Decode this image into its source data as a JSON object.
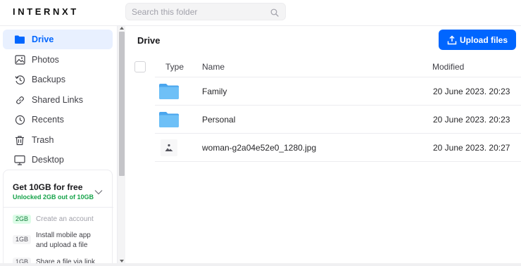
{
  "app": {
    "logo": "INTERNXT"
  },
  "search": {
    "placeholder": "Search this folder"
  },
  "sidebar": {
    "items": [
      {
        "label": "Drive",
        "icon": "folder-icon",
        "active": true
      },
      {
        "label": "Photos",
        "icon": "image-icon"
      },
      {
        "label": "Backups",
        "icon": "clock-counter-icon"
      },
      {
        "label": "Shared Links",
        "icon": "link-icon"
      },
      {
        "label": "Recents",
        "icon": "clock-icon"
      },
      {
        "label": "Trash",
        "icon": "trash-icon"
      },
      {
        "label": "Desktop",
        "icon": "desktop-icon"
      }
    ],
    "promo": {
      "title": "Get 10GB for free",
      "subtitle": "Unlocked 2GB out of 10GB",
      "tasks": [
        {
          "badge": "2GB",
          "text": "Create an account",
          "done": true
        },
        {
          "badge": "1GB",
          "text": "Install mobile app and upload a file",
          "done": false
        },
        {
          "badge": "1GB",
          "text": "Share a file via link",
          "done": false
        }
      ]
    }
  },
  "main": {
    "title": "Drive",
    "upload_label": "Upload files",
    "columns": {
      "type": "Type",
      "name": "Name",
      "modified": "Modified"
    },
    "rows": [
      {
        "kind": "folder",
        "icon": "folder-icon",
        "name": "Family",
        "modified": "20 June 2023. 20:23"
      },
      {
        "kind": "folder",
        "icon": "folder-icon",
        "name": "Personal",
        "modified": "20 June 2023. 20:23"
      },
      {
        "kind": "image",
        "icon": "image-file-icon",
        "name": "woman-g2a04e52e0_1280.jpg",
        "modified": "20 June 2023. 20:27"
      }
    ]
  },
  "colors": {
    "accent": "#0066ff",
    "success": "#16a34a",
    "folder": "#60b4f5"
  }
}
